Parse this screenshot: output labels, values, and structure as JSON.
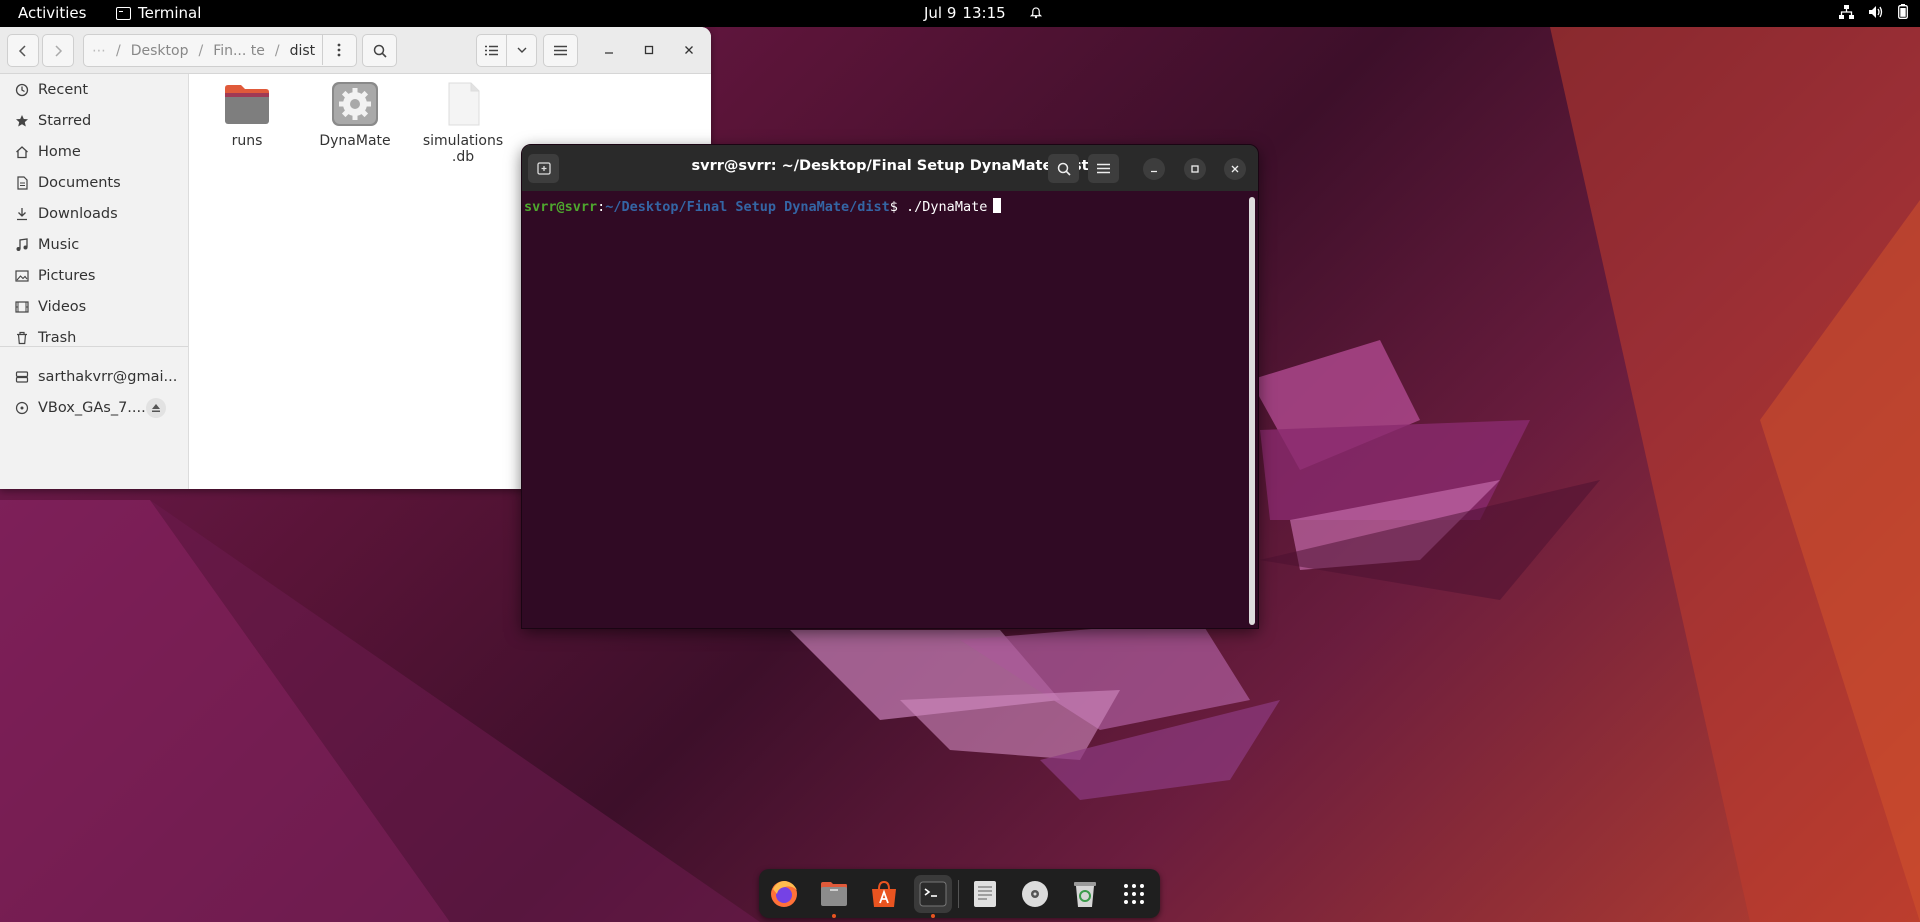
{
  "topbar": {
    "activities": "Activities",
    "app_name": "Terminal",
    "date": "Jul 9",
    "time": "13:15"
  },
  "files": {
    "path": {
      "crumb_hidden": "⋯",
      "crumb_desktop": "Desktop",
      "crumb_mid": "Fin... te",
      "crumb_current": "dist"
    },
    "sidebar": [
      {
        "label": "Recent",
        "icon": "clock-icon"
      },
      {
        "label": "Starred",
        "icon": "star-icon"
      },
      {
        "label": "Home",
        "icon": "home-icon"
      },
      {
        "label": "Documents",
        "icon": "document-icon"
      },
      {
        "label": "Downloads",
        "icon": "download-icon"
      },
      {
        "label": "Music",
        "icon": "music-icon"
      },
      {
        "label": "Pictures",
        "icon": "picture-icon"
      },
      {
        "label": "Videos",
        "icon": "video-icon"
      },
      {
        "label": "Trash",
        "icon": "trash-icon"
      }
    ],
    "devices": [
      {
        "label": "sarthakvrr@gmai...",
        "icon": "network-drive-icon"
      },
      {
        "label": "VBox_GAs_7....",
        "icon": "disc-icon"
      }
    ],
    "items": [
      {
        "name": "runs",
        "type": "folder"
      },
      {
        "name": "DynaMate",
        "type": "executable"
      },
      {
        "name": "simulations\n.db",
        "line1": "simulations",
        "line2": ".db",
        "type": "file"
      }
    ]
  },
  "terminal": {
    "title": "svrr@svrr: ~/Desktop/Final Setup DynaMate/dist",
    "prompt_user": "svrr@svrr",
    "prompt_colon": ":",
    "prompt_path": "~/Desktop/Final Setup DynaMate/dist",
    "prompt_symbol": "$ ",
    "command": "./DynaMate"
  },
  "dock": [
    {
      "name": "firefox",
      "running": false
    },
    {
      "name": "files",
      "running": true
    },
    {
      "name": "software",
      "running": false
    },
    {
      "name": "terminal",
      "running": true,
      "active": true
    },
    {
      "name": "text-editor",
      "running": false
    },
    {
      "name": "disc",
      "running": false
    },
    {
      "name": "trash",
      "running": false
    },
    {
      "name": "show-apps",
      "running": false
    }
  ],
  "colors": {
    "terminal_bg": "#300a24",
    "accent": "#e95420",
    "prompt_user": "#4ea72e",
    "prompt_path": "#3465a4"
  }
}
